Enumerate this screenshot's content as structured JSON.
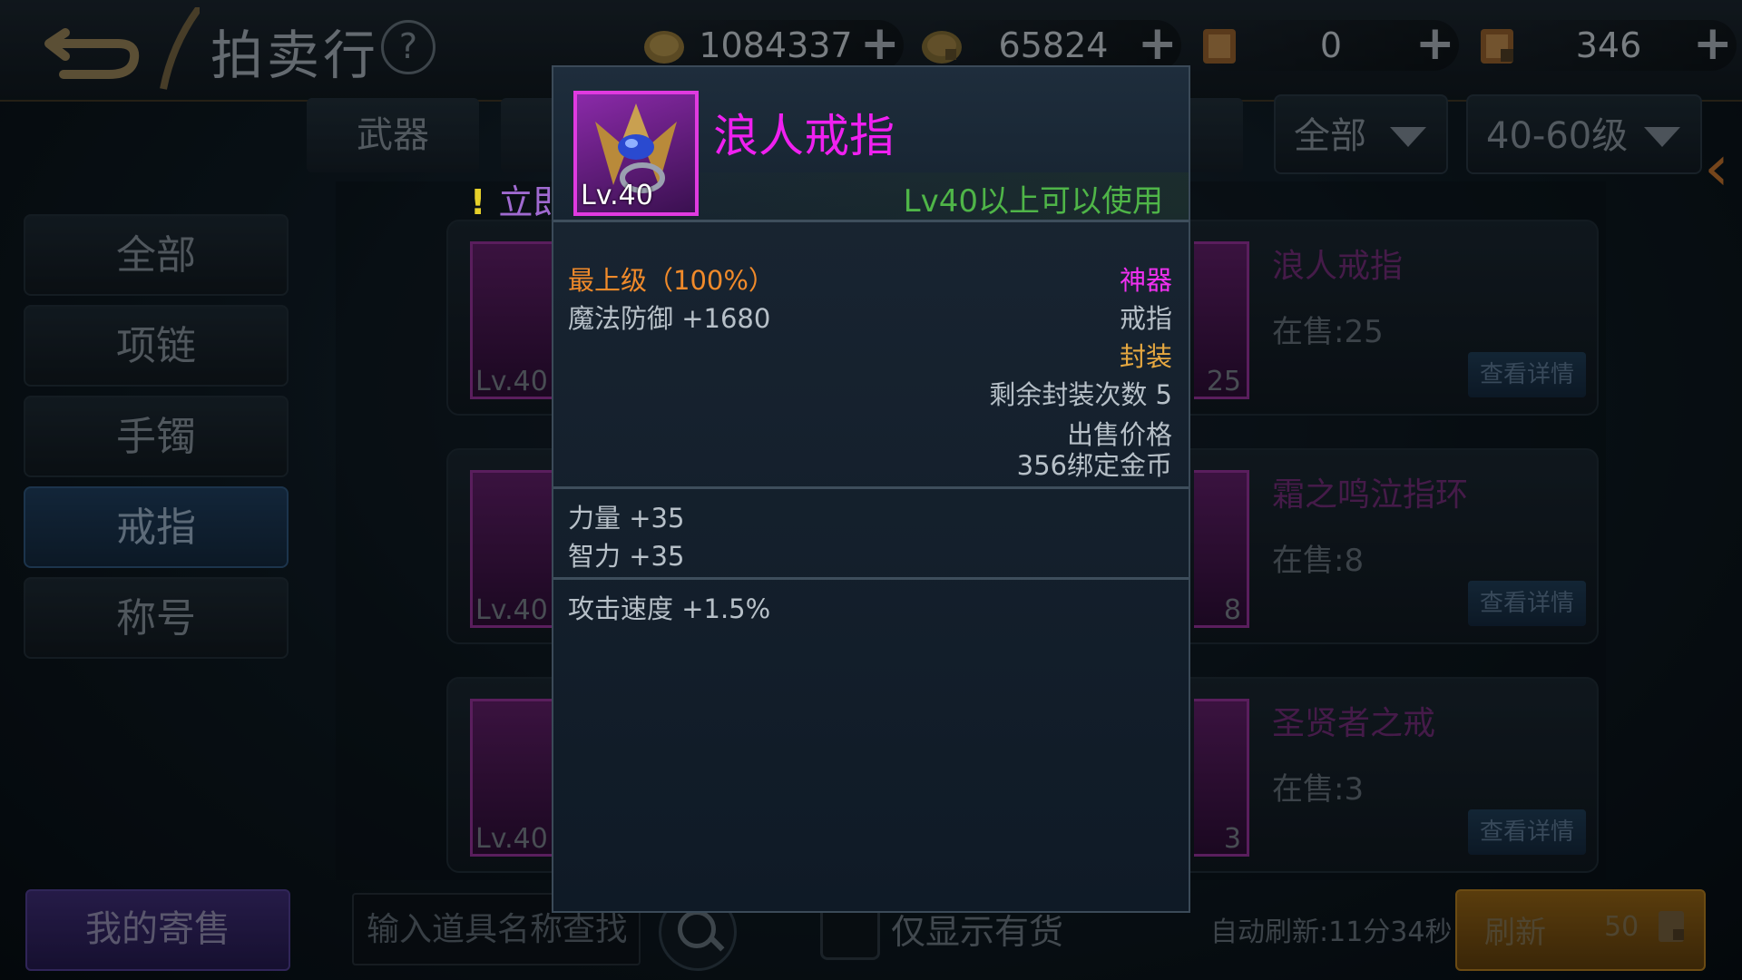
{
  "header": {
    "title": "拍卖行",
    "help_symbol": "?",
    "currencies": [
      {
        "icon": "gold-coin-icon",
        "value": "1084337",
        "plus": "+"
      },
      {
        "icon": "bound-coin-icon",
        "value": "65824",
        "plus": "+"
      },
      {
        "icon": "scroll-icon",
        "value": "0",
        "plus": "+"
      },
      {
        "icon": "locked-scroll-icon",
        "value": "346",
        "plus": "+"
      }
    ]
  },
  "category_tabs": {
    "first": "武器"
  },
  "filters": {
    "type": "全部",
    "level": "40-60级"
  },
  "sidebar": {
    "items": [
      {
        "label": "全部"
      },
      {
        "label": "项链"
      },
      {
        "label": "手镯"
      },
      {
        "label": "戒指"
      },
      {
        "label": "称号"
      }
    ],
    "active": "戒指"
  },
  "promo": {
    "mark": "!",
    "text": "立即前往>>"
  },
  "listings": [
    {
      "level": "Lv.40",
      "count": "25",
      "name": "浪人戒指",
      "stock": "在售:25",
      "detail": "查看详情"
    },
    {
      "level": "Lv.40",
      "count": "8",
      "name": "霜之鸣泣指环",
      "stock": "在售:8",
      "detail": "查看详情"
    },
    {
      "level": "Lv.40",
      "count": "3",
      "name": "圣贤者之戒",
      "stock": "在售:3",
      "detail": "查看详情"
    }
  ],
  "bottom": {
    "my_consignment": "我的寄售",
    "search_placeholder": "输入道具名称查找",
    "in_stock_only": "仅显示有货",
    "auto_refresh": "自动刷新:11分34秒",
    "refresh": "刷新",
    "refresh_cost": "50"
  },
  "tooltip": {
    "name": "浪人戒指",
    "icon_level": "Lv.40",
    "requirement": "Lv40以上可以使用",
    "quality": "最上级（100%）",
    "rarity": "神器",
    "base_stat": "魔法防御 +1680",
    "slot": "戒指",
    "sealed": "封装",
    "seal_remaining": "剩余封装次数 5",
    "sell_price_label": "出售价格",
    "sell_price": "356绑定金币",
    "bonus_stats": [
      "力量 +35",
      "智力 +35"
    ],
    "extra_stat": "攻击速度 +1.5%"
  },
  "colors": {
    "rarity_epic": "#f030f0",
    "quality_orange": "#f08a2a",
    "requirement_green": "#4fb548",
    "sealed_gold": "#e6a840"
  }
}
